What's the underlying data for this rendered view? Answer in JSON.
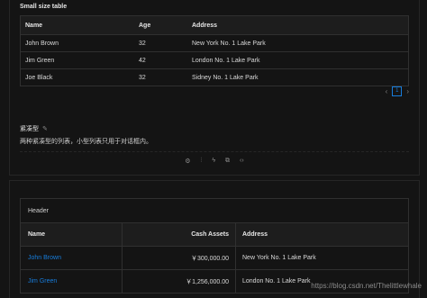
{
  "small_table": {
    "title": "Small size table",
    "columns": [
      "Name",
      "Age",
      "Address"
    ],
    "rows": [
      {
        "name": "John Brown",
        "age": "32",
        "address": "New York No. 1 Lake Park"
      },
      {
        "name": "Jim Green",
        "age": "42",
        "address": "London No. 1 Lake Park"
      },
      {
        "name": "Joe Black",
        "age": "32",
        "address": "Sidney No. 1 Lake Park"
      }
    ],
    "pagination": {
      "prev": "‹",
      "page": "1",
      "next": "›"
    }
  },
  "demo": {
    "title": "紧凑型",
    "edit_icon": "✎",
    "description": "两种紧凑型的列表，小型列表只用于对话框内。",
    "actions": [
      "⚙",
      "⫶",
      "ϟ",
      "⧉",
      "‹›"
    ]
  },
  "bordered_table": {
    "header": "Header",
    "columns": [
      "Name",
      "Cash Assets",
      "Address"
    ],
    "rows": [
      {
        "name": "John Brown",
        "cash": "￥300,000.00",
        "address": "New York No. 1 Lake Park"
      },
      {
        "name": "Jim Green",
        "cash": "￥1,256,000.00",
        "address": "London No. 1 Lake Park"
      }
    ]
  },
  "watermark": "https://blog.csdn.net/Thelittlewhale",
  "colors": {
    "background": "#141414",
    "link": "#177ddc",
    "border": "#303030"
  }
}
